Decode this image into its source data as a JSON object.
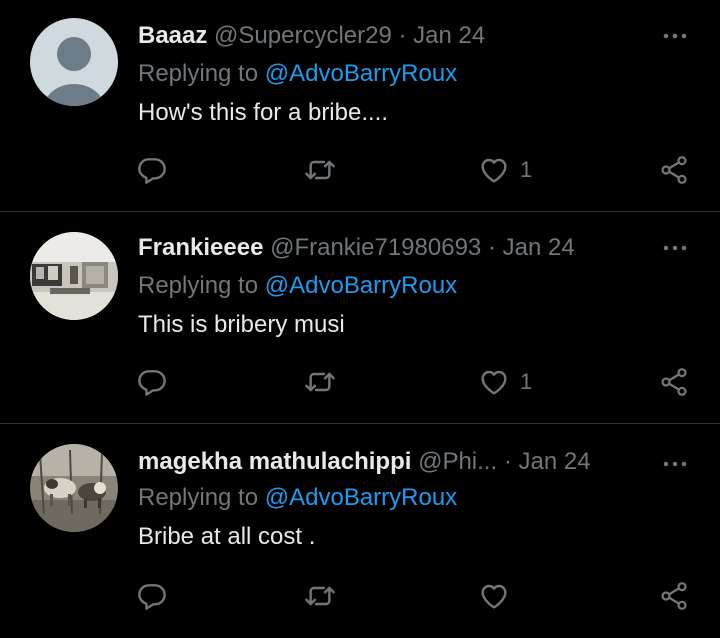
{
  "colors": {
    "background": "#000000",
    "primary_text": "#e7e9ea",
    "secondary_text": "#71767b",
    "accent": "#1d9bf0",
    "divider": "#2f3336"
  },
  "tweets": [
    {
      "display_name": "Baaaz",
      "handle": "@Supercycler29",
      "separator": "·",
      "date": "Jan 24",
      "replying_prefix": "Replying to",
      "replying_to": "@AdvoBarryRoux",
      "text": "How's this for a bribe....",
      "likes": "1",
      "avatar": "default-avatar"
    },
    {
      "display_name": "Frankieeee",
      "handle": "@Frankie71980693",
      "separator": "·",
      "date": "Jan 24",
      "replying_prefix": "Replying to",
      "replying_to": "@AdvoBarryRoux",
      "text": "This is bribery musi",
      "likes": "1",
      "avatar": "room-photo-avatar"
    },
    {
      "display_name": "magekha mathulachippi",
      "handle": "@Phi...",
      "separator": "·",
      "date": "Jan 24",
      "replying_prefix": "Replying to",
      "replying_to": "@AdvoBarryRoux",
      "text": "Bribe at all cost .",
      "likes": "",
      "avatar": "livestock-photo-avatar"
    }
  ],
  "icons": {
    "more": "more-horizontal-icon",
    "reply": "reply-icon",
    "retweet": "retweet-icon",
    "like": "heart-icon",
    "share": "share-icon"
  }
}
